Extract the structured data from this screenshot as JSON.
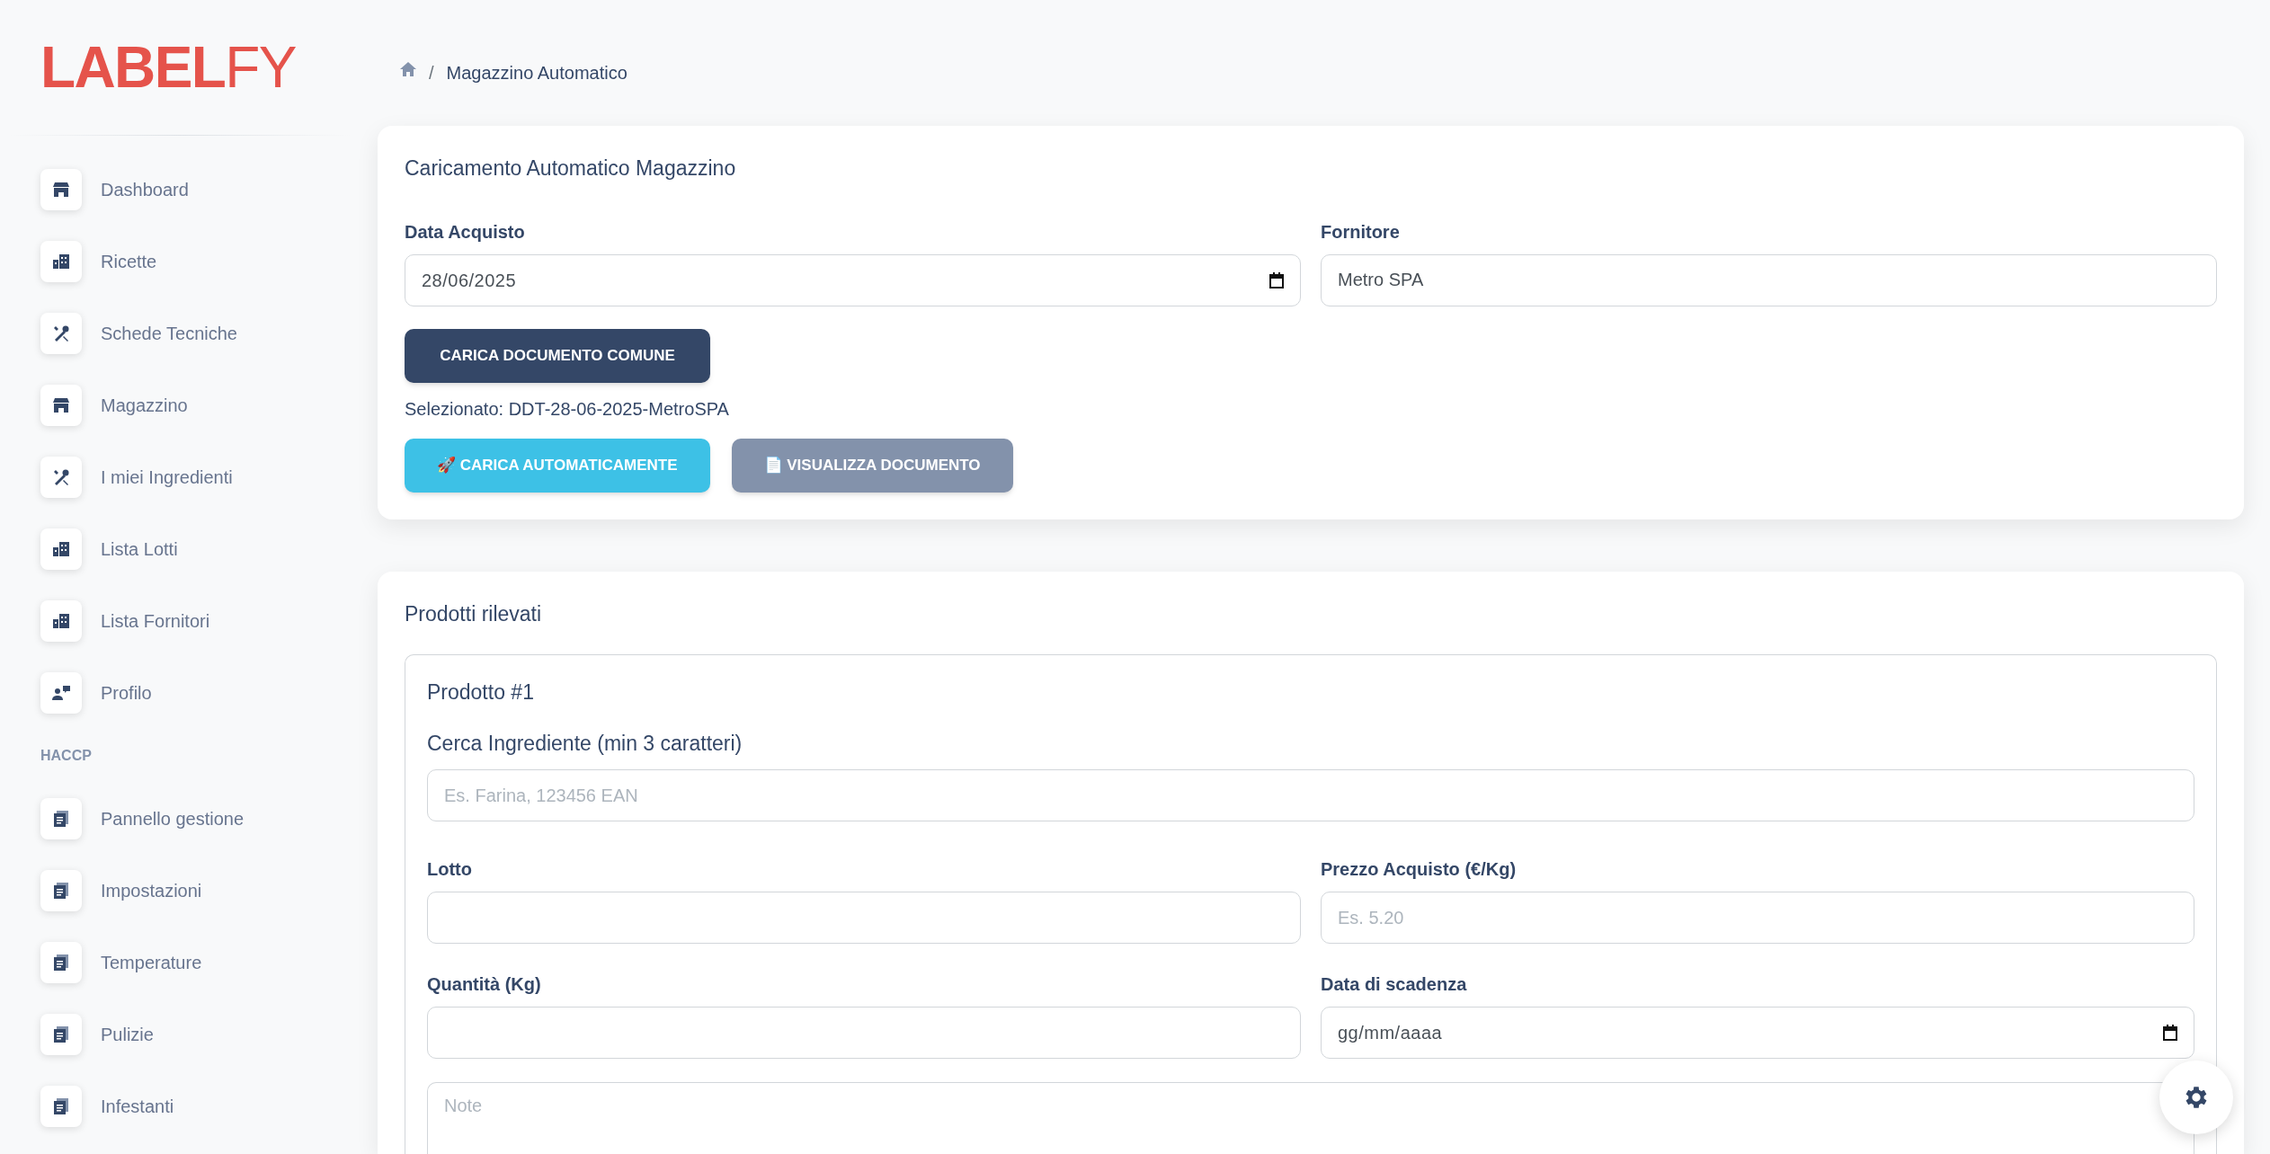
{
  "logo": "**LABEL**FY",
  "sidebar": {
    "items": [
      {
        "label": "Dashboard",
        "kind": "store"
      },
      {
        "label": "Ricette",
        "kind": "building"
      },
      {
        "label": "Schede Tecniche",
        "kind": "tools"
      },
      {
        "label": "Magazzino",
        "kind": "store"
      },
      {
        "label": "I miei Ingredienti",
        "kind": "tools"
      },
      {
        "label": "Lista Lotti",
        "kind": "building"
      },
      {
        "label": "Lista Fornitori",
        "kind": "building"
      },
      {
        "label": "Profilo",
        "kind": "user"
      }
    ],
    "section_title": "HACCP",
    "section_items": [
      {
        "label": "Pannello gestione",
        "kind": "document"
      },
      {
        "label": "Impostazioni",
        "kind": "document"
      },
      {
        "label": "Temperature",
        "kind": "document"
      },
      {
        "label": "Pulizie",
        "kind": "document"
      },
      {
        "label": "Infestanti",
        "kind": "document"
      }
    ]
  },
  "breadcrumb": {
    "separator": "/",
    "current": "Magazzino Automatico"
  },
  "upload_card": {
    "title": "Caricamento Automatico Magazzino",
    "purchase_date": {
      "label": "Data Acquisto",
      "value": "28/06/2025"
    },
    "supplier": {
      "label": "Fornitore",
      "value": "Metro SPA"
    },
    "upload_button": "CARICA DOCUMENTO COMUNE",
    "selected_file": "Selezionato: DDT-28-06-2025-MetroSPA",
    "auto_button": {
      "icon": "🚀",
      "label": "CARICA AUTOMATICAMENTE"
    },
    "view_button": {
      "icon": "📄",
      "label": "VISUALIZZA DOCUMENTO"
    }
  },
  "products_card": {
    "title": "Prodotti rilevati",
    "products": [
      {
        "title": "Prodotto #1",
        "search": {
          "label": "Cerca Ingrediente (min 3 caratteri)",
          "placeholder": "Es. Farina, 123456 EAN"
        },
        "lot": {
          "label": "Lotto"
        },
        "price": {
          "label": "Prezzo Acquisto (€/Kg)",
          "placeholder": "Es. 5.20"
        },
        "quantity": {
          "label": "Quantità (Kg)"
        },
        "expiry": {
          "label": "Data di scadenza",
          "value": "gg/mm/aaaa"
        },
        "notes": {
          "placeholder": "Note"
        }
      }
    ]
  }
}
